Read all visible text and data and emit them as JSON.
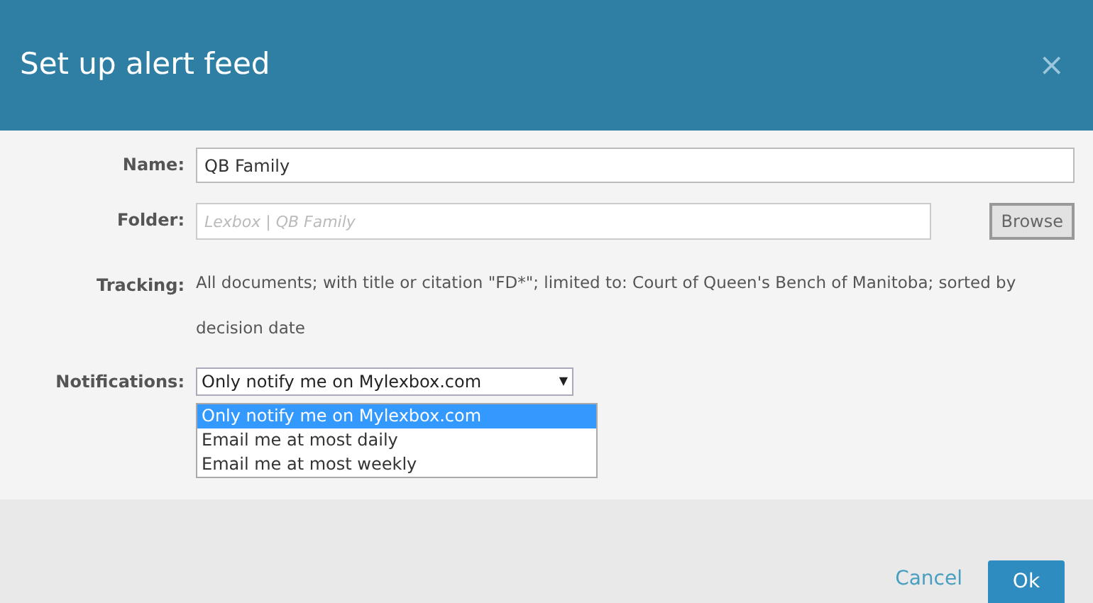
{
  "dialog": {
    "title": "Set up alert feed",
    "close": "×"
  },
  "fields": [
    {
      "kind": "input",
      "label": "Name:",
      "value": "QB Family"
    },
    {
      "kind": "folder",
      "label": "Folder:",
      "placeholder": "Lexbox | QB Family",
      "button": "Browse"
    },
    {
      "kind": "text",
      "label": "Tracking:",
      "text": "All documents; with title or citation \"FD*\"; limited to: Court of Queen's Bench of Manitoba; sorted by decision date"
    },
    {
      "kind": "select",
      "label": "Notifications:",
      "value": "Only notify me on Mylexbox.com",
      "arrow": "▼",
      "options": [
        {
          "label": "Only notify me on Mylexbox.com",
          "selected": true
        },
        {
          "label": "Email me at most daily",
          "selected": false
        },
        {
          "label": "Email me at most weekly",
          "selected": false
        }
      ]
    }
  ],
  "buttons": [
    {
      "label": "Cancel",
      "kind": "link"
    },
    {
      "label": "Ok",
      "kind": "primary"
    }
  ]
}
